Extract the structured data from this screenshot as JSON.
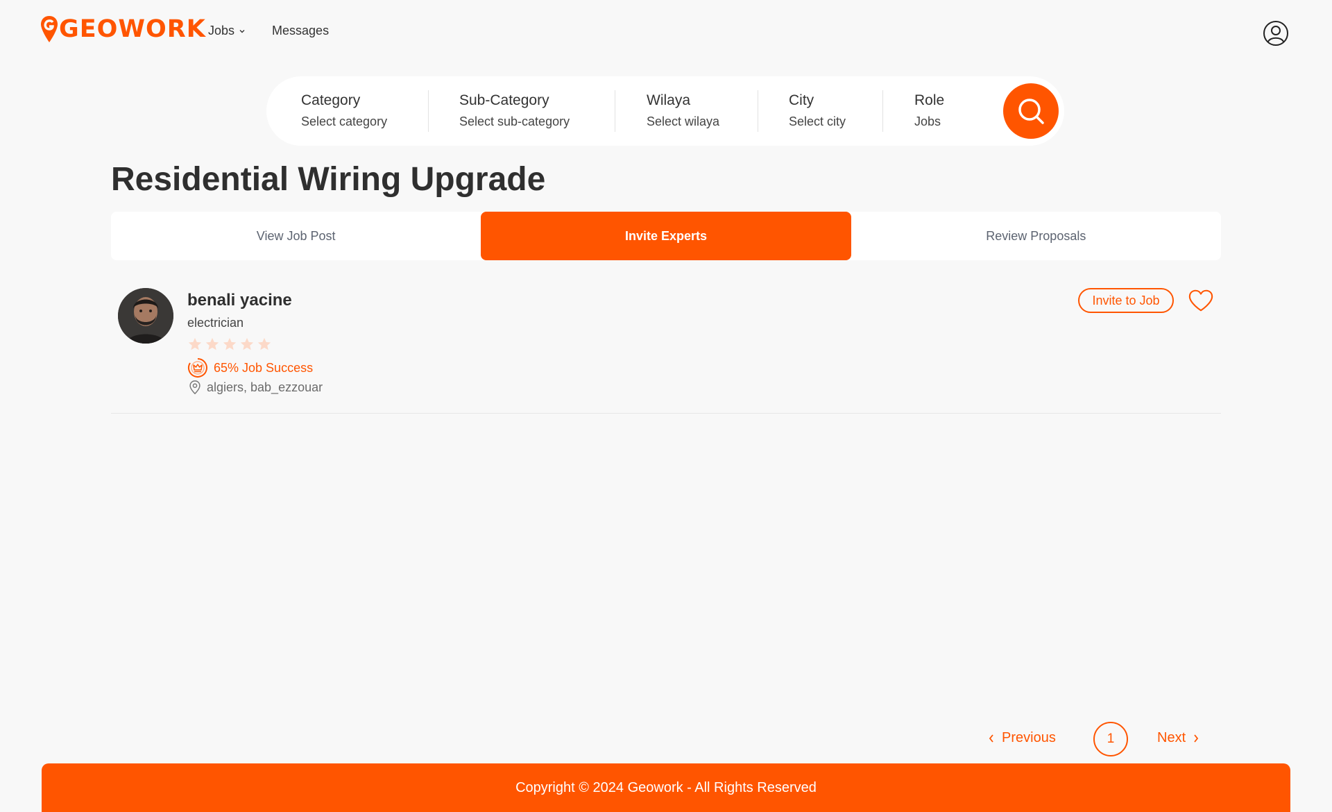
{
  "brand": {
    "logo_text": "GEOWORK",
    "accent_color": "#ff5500"
  },
  "nav": {
    "jobs_label": "Jobs",
    "messages_label": "Messages",
    "user_icon": "user-circle-icon"
  },
  "search": {
    "filters": [
      {
        "label": "Category",
        "value": "Select category"
      },
      {
        "label": "Sub-Category",
        "value": "Select sub-category"
      },
      {
        "label": "Wilaya",
        "value": "Select wilaya"
      },
      {
        "label": "City",
        "value": "Select city"
      },
      {
        "label": "Role",
        "value": "Jobs"
      }
    ],
    "button_icon": "search-icon"
  },
  "page": {
    "title": "Residential Wiring Upgrade"
  },
  "tabs": [
    {
      "label": "View Job Post",
      "active": false
    },
    {
      "label": "Invite Experts",
      "active": true
    },
    {
      "label": "Review Proposals",
      "active": false
    }
  ],
  "experts": [
    {
      "name": "benali yacine",
      "role": "electrician",
      "rating": 0,
      "rating_max": 5,
      "job_success": "65% Job Success",
      "location": "algiers, bab_ezzouar",
      "invite_label": "Invite to Job"
    }
  ],
  "pagination": {
    "previous_label": "Previous",
    "current_page": "1",
    "next_label": "Next"
  },
  "footer": {
    "copyright": "Copyright © 2024 Geowork - All Rights Reserved"
  }
}
